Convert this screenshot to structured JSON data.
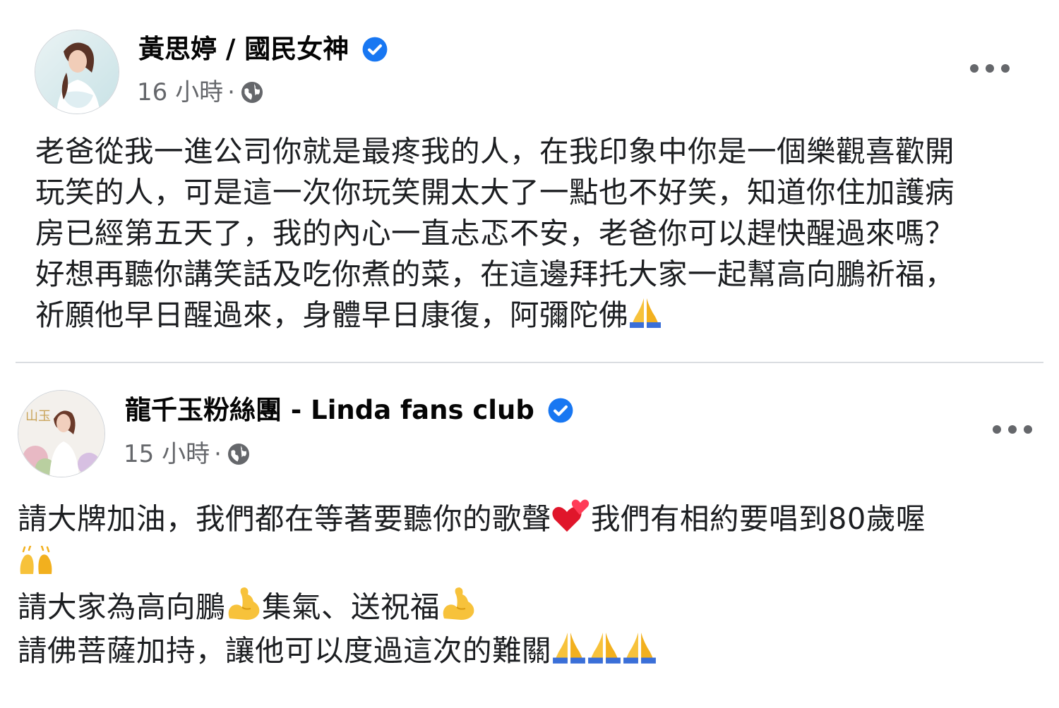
{
  "posts": [
    {
      "author": "黃思婷 / 國民女神",
      "verified": true,
      "time": "16 小時",
      "separator": "·",
      "visibility_icon": "globe-icon",
      "more_icon": "more-options-icon",
      "lines": [
        "老爸從我一進公司你就是最疼我的人，在我印象中你是一個樂觀喜歡開",
        "玩笑的人，可是這一次你玩笑開太大了一點也不好笑，知道你住加護病",
        "房已經第五天了，我的內心一直忐忑不安，老爸你可以趕快醒過來嗎？",
        "好想再聽你講笑話及吃你煮的菜，在這邊拜托大家一起幫高向鵬祈福，",
        "祈願他早日醒過來，身體早日康復，阿彌陀佛"
      ]
    },
    {
      "author": "龍千玉粉絲團 - Linda fans club",
      "verified": true,
      "time": "15 小時",
      "separator": "·",
      "visibility_icon": "globe-icon",
      "more_icon": "more-options-icon",
      "lines": {
        "l1a": "請大牌加油，我們都在等著要聽你的歌聲",
        "l1b": "我們有相約要唱到80歲喔",
        "l3a": "請大家為高向鵬",
        "l3b": "集氣、送祝福",
        "l4": "請佛菩薩加持，讓他可以度過這次的難關"
      }
    }
  ],
  "colors": {
    "verified": "#1877f2",
    "meta_text": "#65676b",
    "divider": "#dadde1"
  }
}
